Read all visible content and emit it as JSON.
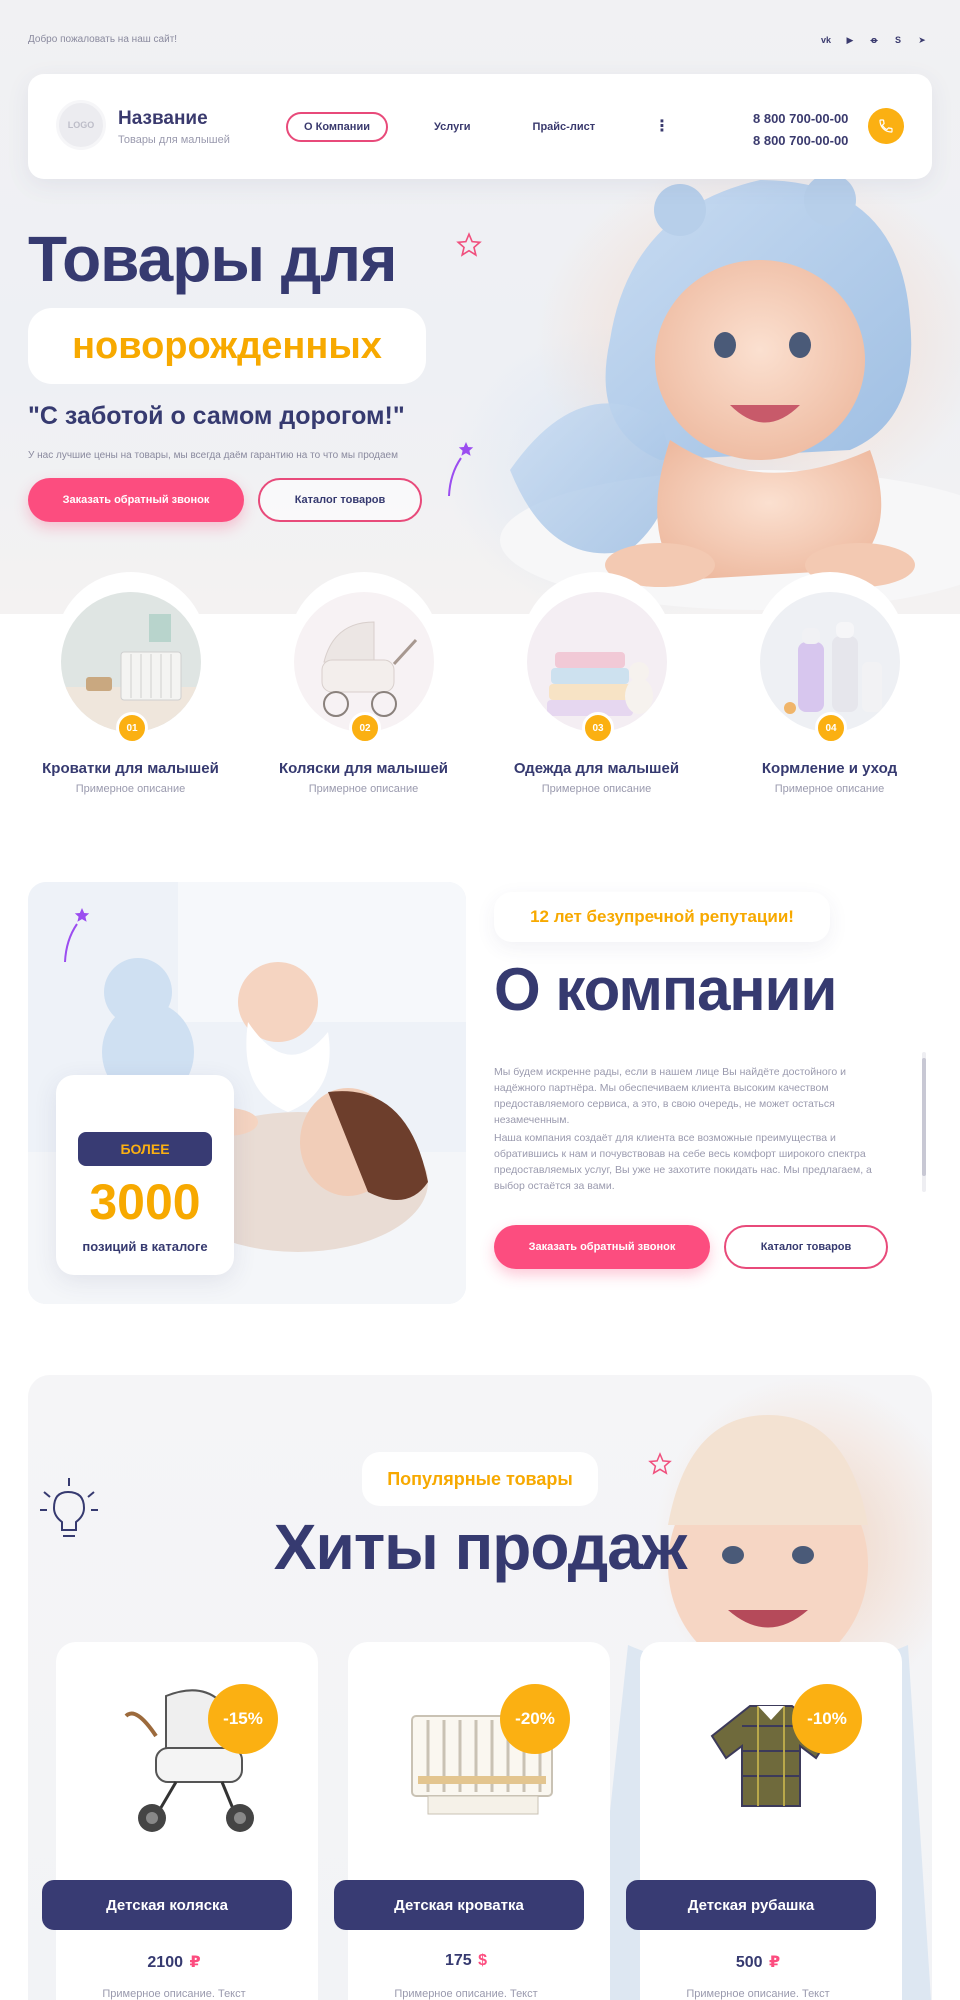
{
  "topbar": {
    "welcome": "Добро пожаловать на наш сайт!",
    "social_icons": [
      "vk-icon",
      "youtube-icon",
      "odnoklassniki-icon",
      "skype-icon",
      "telegram-icon"
    ]
  },
  "header": {
    "logo": "LOGO",
    "brand_name": "Название",
    "brand_sub": "Товары для малышей",
    "nav": [
      {
        "label": "О Компании",
        "active": true
      },
      {
        "label": "Услуги",
        "active": false
      },
      {
        "label": "Прайс-лист",
        "active": false
      }
    ],
    "more_label": "⋮",
    "phones": [
      "8 800 700-00-00",
      "8 800 700-00-00"
    ]
  },
  "hero": {
    "title": "Товары для",
    "highlight": "новорожденных",
    "subtitle": "\"С заботой о самом дорогом!\"",
    "description": "У нас лучшие цены на товары, мы всегда даём гарантию на то что мы продаем",
    "cta_primary": "Заказать обратный звонок",
    "cta_secondary": "Каталог товаров"
  },
  "categories": [
    {
      "num": "01",
      "title": "Кроватки для малышей",
      "desc": "Примерное описание"
    },
    {
      "num": "02",
      "title": "Коляски для малышей",
      "desc": "Примерное описание"
    },
    {
      "num": "03",
      "title": "Одежда для малышей",
      "desc": "Примерное описание"
    },
    {
      "num": "04",
      "title": "Кормление и уход",
      "desc": "Примерное описание"
    }
  ],
  "about": {
    "stat_badge": "БОЛЕЕ",
    "stat_number": "3000",
    "stat_label": "позиций в каталоге",
    "reputation": "12 лет безупречной репутации!",
    "title": "О компании",
    "paragraph_1": "Мы будем искренне рады, если в нашем лице Вы найдёте достойного и надёжного партнёра. Мы обеспечиваем клиента высоким качеством предоставляемого сервиса, а это, в свою очередь, не может остаться незамеченным.",
    "paragraph_2": "Наша компания создаёт для клиента все возможные преимущества и обратившись к нам и почувствовав на себе весь комфорт широкого спектра предоставляемых услуг, Вы уже не захотите покидать нас. Мы предлагаем, а выбор остаётся за вами.",
    "cta_primary": "Заказать обратный звонок",
    "cta_secondary": "Каталог товаров"
  },
  "hits": {
    "pill": "Популярные товары",
    "title": "Хиты продаж",
    "products": [
      {
        "name": "Детская коляска",
        "discount": "-15%",
        "price": "2100",
        "currency": "₽",
        "desc": "Примерное описание. Текст"
      },
      {
        "name": "Детская кроватка",
        "discount": "-20%",
        "price": "175",
        "currency": "$",
        "desc": "Примерное описание. Текст"
      },
      {
        "name": "Детская рубашка",
        "discount": "-10%",
        "price": "500",
        "currency": "₽",
        "desc": "Примерное описание. Текст"
      }
    ]
  },
  "colors": {
    "navy": "#363a70",
    "pink": "#fc4d7f",
    "yellow": "#fbb012"
  }
}
